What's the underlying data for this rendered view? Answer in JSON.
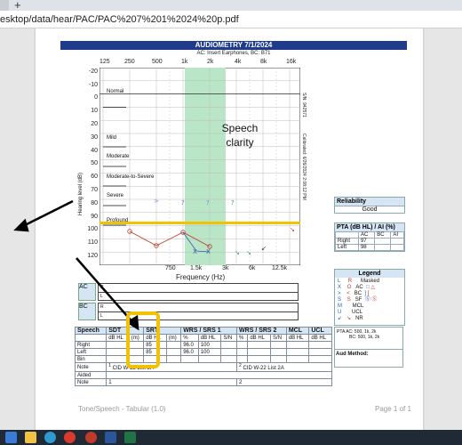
{
  "browser": {
    "new_tab_symbol": "+",
    "url": "esktop/data/hear/PAC/PAC%207%201%2024%20p.pdf"
  },
  "report": {
    "title": "AUDIOMETRY  7/1/2024",
    "subtitle": "AC: Insert Earphones, BC: B71",
    "freq_top": [
      "125",
      "250",
      "500",
      "1k",
      "2k",
      "4k",
      "8k",
      "16k"
    ],
    "freq_bottom": [
      "750",
      "1.5k",
      "3k",
      "6k",
      "12.5k"
    ],
    "freq_axis_title": "Frequency (Hz)",
    "hl_axis_title": "Hearing level (dB)",
    "y_ticks": [
      "-20",
      "-10",
      "0",
      "10",
      "20",
      "30",
      "40",
      "50",
      "60",
      "70",
      "80",
      "90",
      "100",
      "110",
      "120"
    ],
    "sn": "S/N: 942571",
    "calibrated": "Calibrated: 6/26/2024 2:08:12 PM",
    "bands": [
      "Normal",
      "Mild",
      "Moderate",
      "Moderate-to-Severe",
      "Severe",
      "Profound"
    ],
    "speech_clarity": "Speech clarity",
    "reliability": {
      "label": "Reliability",
      "value": "Good"
    },
    "pta": {
      "label": "PTA (dB HL) / AI (%)",
      "cols": [
        "",
        "AC",
        "BC",
        "AI"
      ],
      "rows": [
        [
          "Right",
          "97",
          "",
          ""
        ],
        [
          "Left",
          "98",
          "",
          ""
        ]
      ]
    },
    "legend": {
      "label": "Legend",
      "cols": [
        "L",
        "R",
        "Masked"
      ],
      "rows": [
        [
          "X",
          "O",
          "AC",
          "□",
          "△"
        ],
        [
          ">",
          "<",
          "BC",
          "]",
          "["
        ],
        [
          "S",
          "S",
          "SF",
          "Ⓢ",
          "Ⓢ"
        ],
        [
          "M",
          "",
          "MCL",
          "",
          ""
        ],
        [
          "U",
          "",
          "UCL",
          "",
          ""
        ],
        [
          "↙",
          "↘",
          "NR",
          "",
          ""
        ]
      ]
    },
    "pta_notes": [
      "PTA  AC: 500, 1k, 2k",
      "BC: 500, 1k, 2k"
    ],
    "aud_method": "Aud Method:",
    "transducer_tags": [
      "AC",
      "BC"
    ],
    "transducer_rows": [
      "R",
      "L",
      "R",
      "L"
    ],
    "speech": {
      "headers": [
        "Speech",
        "SDT",
        "SRT",
        "WRS / SRS 1",
        "WRS / SRS 2",
        "MCL",
        "UCL"
      ],
      "subheaders": [
        "dB HL",
        "(m)",
        "dB HL",
        "(m)",
        "%",
        "dB HL",
        "S/N",
        "%",
        "dB HL",
        "S/N",
        "dB HL",
        "dB HL"
      ],
      "rows": [
        {
          "label": "Right",
          "srt": "85",
          "wrs": "96.0",
          "wrs_db": "100"
        },
        {
          "label": "Left",
          "srt": "85",
          "wrs": "96.0",
          "wrs_db": "100"
        },
        {
          "label": "Bin",
          "srt": "",
          "wrs": "",
          "wrs_db": ""
        }
      ],
      "note_label": "Note",
      "aided_label": "Aided",
      "note1": "CID W-22 List 2A",
      "note2": "CID W-22 List 2A",
      "note_num1": "1",
      "note_num2": "2"
    },
    "footer_left": "Tone/Speech - Tabular (1.0)",
    "footer_right": "Page 1 of 1"
  },
  "colors": {
    "title_bar": "#1f3c8a",
    "speech_band": "#b9e6c6",
    "highlight": "#f2c100",
    "right_ear": "#c0392b",
    "left_ear": "#2b5fb8",
    "panel_header": "#d6e5f4"
  }
}
